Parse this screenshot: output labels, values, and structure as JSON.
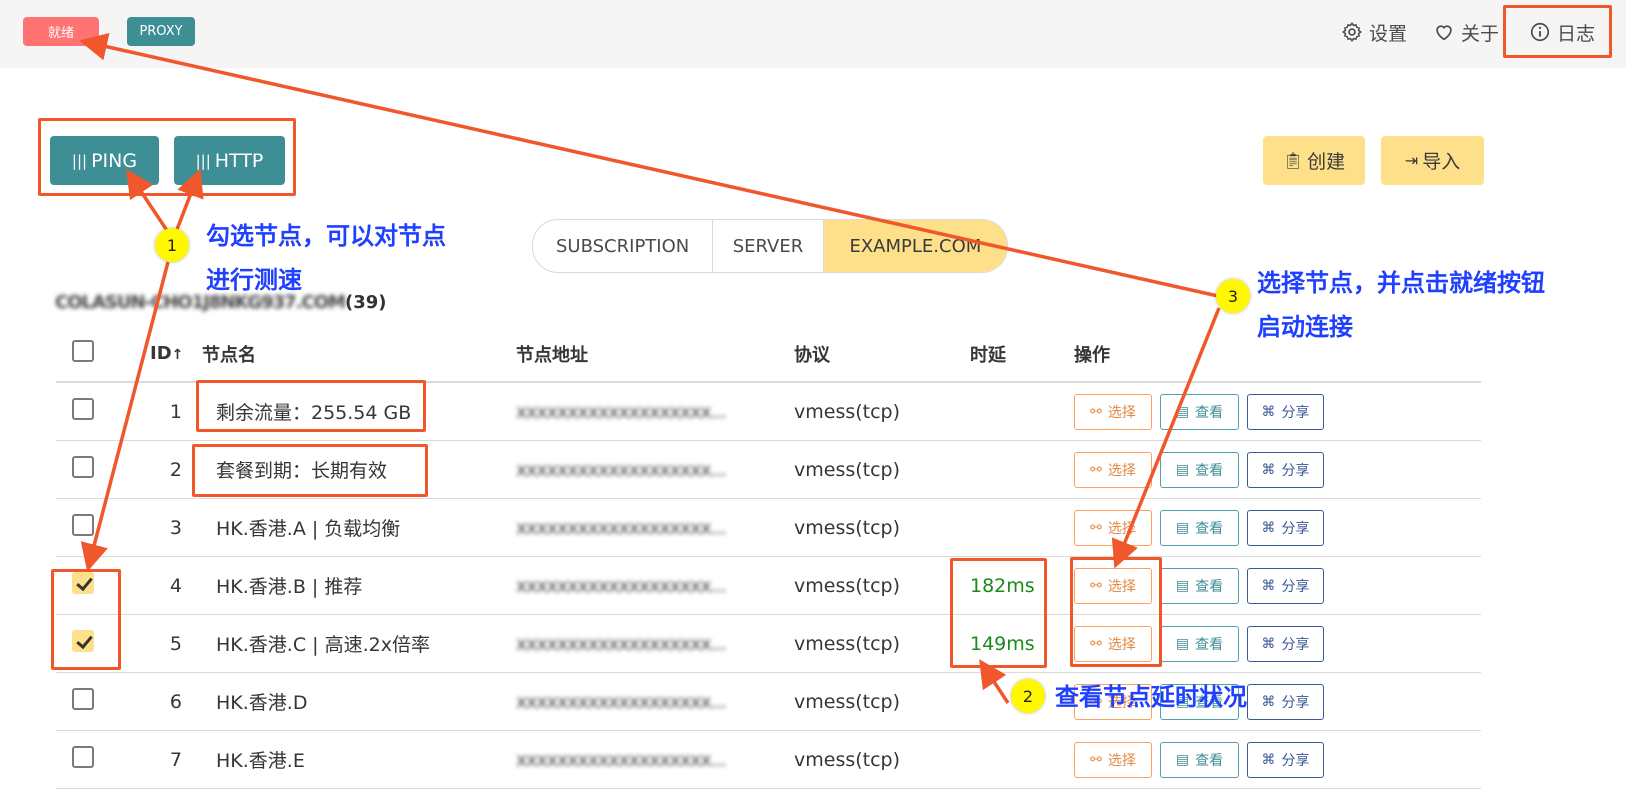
{
  "topbar": {
    "status_tag": "就绪",
    "mode_tag": "PROXY",
    "nav": {
      "settings": "设置",
      "about": "关于",
      "log": "日志"
    }
  },
  "actions": {
    "ping": "PING",
    "http": "HTTP",
    "create": "创建",
    "import": "导入"
  },
  "tabs": [
    "SUBSCRIPTION",
    "SERVER",
    "EXAMPLE.COM"
  ],
  "active_tab": "EXAMPLE.COM",
  "group": {
    "name_blurred": "COLASUN-CHO1J8NKG937.COM",
    "count": "(39)"
  },
  "table": {
    "headers": {
      "id": "ID",
      "name": "节点名",
      "address": "节点地址",
      "protocol": "协议",
      "latency": "时延",
      "ops": "操作"
    },
    "op_labels": {
      "select": "选择",
      "view": "查看",
      "share": "分享"
    },
    "rows": [
      {
        "id": "1",
        "name": "剩余流量：255.54 GB",
        "address": "xxxxxxxxxxxxxxxxxxx...",
        "protocol": "vmess(tcp)",
        "latency": "",
        "checked": false
      },
      {
        "id": "2",
        "name": "套餐到期：长期有效",
        "address": "xxxxxxxxxxxxxxxxxxx...",
        "protocol": "vmess(tcp)",
        "latency": "",
        "checked": false
      },
      {
        "id": "3",
        "name": "HK.香港.A | 负载均衡",
        "address": "xxxxxxxxxxxxxxxxxxx...",
        "protocol": "vmess(tcp)",
        "latency": "",
        "checked": false
      },
      {
        "id": "4",
        "name": "HK.香港.B | 推荐",
        "address": "xxxxxxxxxxxxxxxxxxx...",
        "protocol": "vmess(tcp)",
        "latency": "182ms",
        "checked": true
      },
      {
        "id": "5",
        "name": "HK.香港.C | 高速.2x倍率",
        "address": "xxxxxxxxxxxxxxxxxxx...",
        "protocol": "vmess(tcp)",
        "latency": "149ms",
        "checked": true
      },
      {
        "id": "6",
        "name": "HK.香港.D",
        "address": "xxxxxxxxxxxxxxxxxxx...",
        "protocol": "vmess(tcp)",
        "latency": "",
        "checked": false
      },
      {
        "id": "7",
        "name": "HK.香港.E",
        "address": "xxxxxxxxxxxxxxxxxxx...",
        "protocol": "vmess(tcp)",
        "latency": "",
        "checked": false
      }
    ]
  },
  "annotations": {
    "m1": "1",
    "m2": "2",
    "m3": "3",
    "note1_line1": "勾选节点，可以对节点",
    "note1_line2": "进行测速",
    "note2": "查看节点延时状况",
    "note3_line1": "选择节点，并点击就绪按钮",
    "note3_line2": "启动连接"
  },
  "colors": {
    "teal": "#3e8e96",
    "yellow": "#ffe08a",
    "ready": "#ff7373",
    "annotation_red": "#f0582c",
    "annotation_blue": "#2040ff"
  }
}
